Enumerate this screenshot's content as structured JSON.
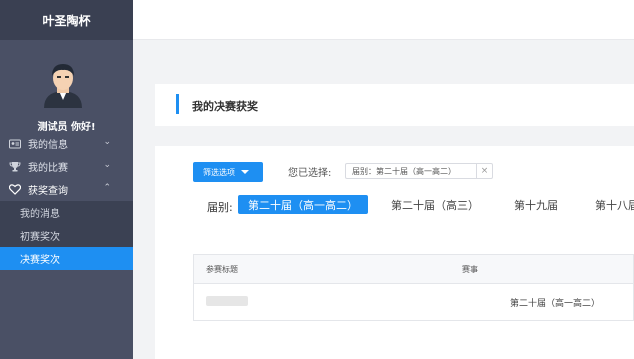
{
  "app": {
    "title": "叶圣陶杯"
  },
  "profile": {
    "greeting": "测试员 你好!",
    "avatar_icon": "avatar-icon"
  },
  "sidebar": {
    "items": [
      {
        "label": "我的信息",
        "icon": "id-card-icon",
        "chevron": "⌄"
      },
      {
        "label": "我的比赛",
        "icon": "trophy-icon",
        "chevron": "⌄"
      },
      {
        "label": "获奖查询",
        "icon": "heart-icon",
        "chevron": "⌃"
      }
    ],
    "subitems": [
      {
        "label": "我的消息"
      },
      {
        "label": "初赛奖次"
      },
      {
        "label": "决赛奖次"
      }
    ]
  },
  "page": {
    "title": "我的决赛获奖"
  },
  "filter": {
    "button_label": "筛选选项",
    "selected_label": "您已选择:",
    "chip_text": "届别：第二十届（高一高二）",
    "chip_close": "×"
  },
  "session": {
    "label": "届别:",
    "tabs": [
      "第二十届（高一高二）",
      "第二十届（高三）",
      "第十九届",
      "第十八届"
    ]
  },
  "table": {
    "headers": [
      "参赛标题",
      "赛事"
    ],
    "rows": [
      {
        "event": "第二十届（高一高二）"
      }
    ]
  },
  "colors": {
    "accent": "#1e8ff2",
    "sidebar": "#4a5065"
  }
}
